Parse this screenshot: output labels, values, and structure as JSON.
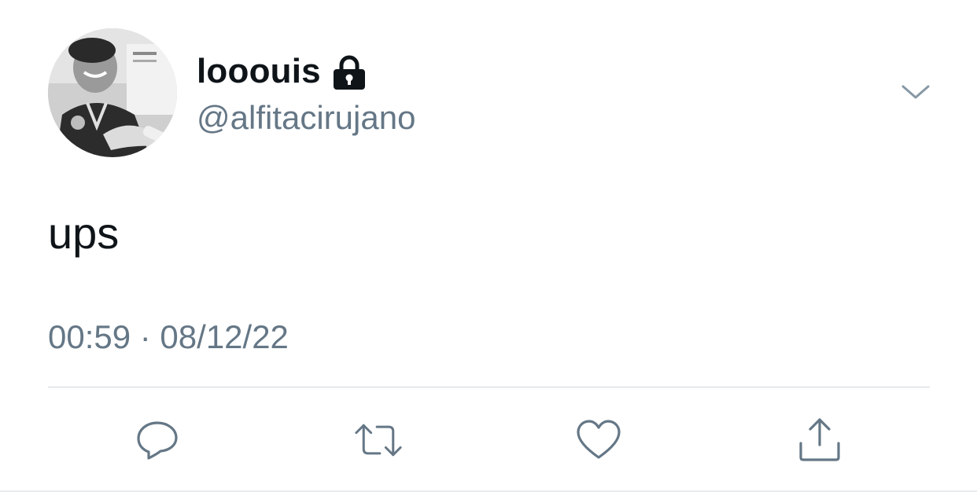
{
  "tweet": {
    "author": {
      "display_name": "looouis",
      "handle": "@alfitacirujano",
      "protected": true
    },
    "text": "ups",
    "timestamp": "00:59 · 08/12/22"
  },
  "icons": {
    "protected": "lock-icon",
    "more": "chevron-down-icon",
    "reply": "reply-icon",
    "retweet": "retweet-icon",
    "like": "heart-icon",
    "share": "share-icon"
  },
  "colors": {
    "text_primary": "#0f1419",
    "text_secondary": "#657786",
    "icon": "#657786",
    "divider": "#cfd9de"
  }
}
